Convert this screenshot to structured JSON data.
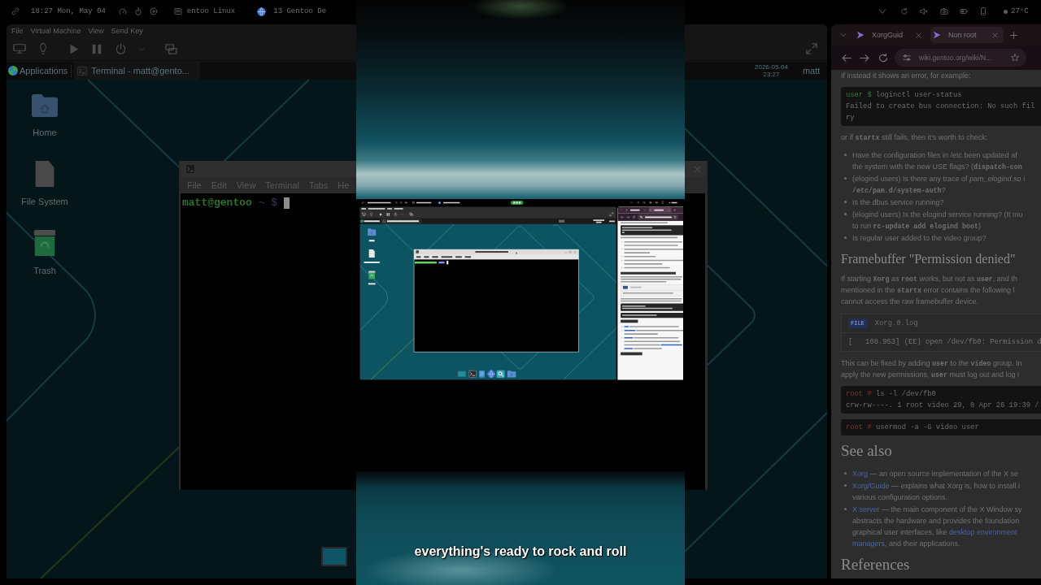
{
  "left_backdrop": {
    "top_bar": {
      "clock": "18:27 Mon, May 04",
      "window_title": "entoo Linux",
      "workspace": "13 Gentoo De"
    },
    "vm_menu": [
      "File",
      "Virtual Machine",
      "View",
      "Send Key"
    ],
    "guest_panel": {
      "menu": "Applications",
      "task": "Terminal - matt@gento..."
    },
    "desktop_icons": [
      {
        "label": "Home",
        "kind": "folder"
      },
      {
        "label": "File System",
        "kind": "drive"
      },
      {
        "label": "Trash",
        "kind": "trash"
      }
    ],
    "terminal": {
      "menu": [
        "File",
        "Edit",
        "View",
        "Terminal",
        "Tabs",
        "He"
      ],
      "user_host": "matt@gentoo",
      "prompt_tail": "~ $"
    }
  },
  "video": {
    "subtitle": "everything's ready to rock and roll"
  },
  "right_backdrop": {
    "top_bar": {
      "temperature": "27°C"
    },
    "guest_panel": {
      "date": "2026-05-04",
      "time": "23:27",
      "user": "matt"
    },
    "browser": {
      "tabs": [
        {
          "label": "XorgGuid",
          "selected": false
        },
        {
          "label": "Non root",
          "selected": true
        }
      ],
      "url": "wiki.gentoo.org/wiki/N...",
      "blocks": [
        {
          "kind": "paragraph",
          "lines": [
            "If instead it shows an error, for example:"
          ]
        },
        {
          "kind": "code",
          "lines": [
            {
              "kind": "user_prompt",
              "prompt": "user $",
              "text": "loginctl user-status"
            },
            {
              "kind": "output",
              "text": "Failed to create bus connection: No such fil"
            },
            {
              "kind": "output",
              "text": "ry"
            }
          ]
        },
        {
          "kind": "paragraph",
          "lines": [
            "or if **startx** still fails, then it's worth to check:"
          ]
        },
        {
          "kind": "bullets",
          "items": [
            [
              "Have the configuration files in /etc been updated af",
              "the system with the new USE flags? (**dispatch-con**"
            ],
            [
              "(elogind users) Is there any trace of *pam_elogind.so* i",
              "**/etc/pam.d/system-auth**?"
            ],
            [
              "Is the dbus service running?"
            ],
            [
              "(elogind users) Is the elogind service running? (It mu",
              "to run **rc-update add elogind boot**)"
            ],
            [
              "Is regular user added to the video group?"
            ]
          ]
        },
        {
          "kind": "heading",
          "text": "Framebuffer \"Permission denied\""
        },
        {
          "kind": "paragraph",
          "lines": [
            "If starting **Xorg** as **root** works, but not as **user**, and th",
            "mentioned in the **startx** error contains the following l",
            "cannot access the raw framebuffer device."
          ]
        },
        {
          "kind": "file",
          "badge": "FILE",
          "name": "Xorg.0.log",
          "lines": [
            "[   108.953] (EE) open /dev/fb0: Permission d"
          ]
        },
        {
          "kind": "paragraph",
          "lines": [
            "This can be fixed by adding **user** to the **video** group. In",
            "apply the new permissions, **user** must log out and log i"
          ]
        },
        {
          "kind": "code",
          "lines": [
            {
              "kind": "root_prompt",
              "prompt": "root #",
              "text": "ls -l /dev/fb0"
            },
            {
              "kind": "output",
              "text": "crw-rw----. 1 root video 29, 0 Apr 26 19:39 /"
            }
          ]
        },
        {
          "kind": "code",
          "lines": [
            {
              "kind": "root_prompt",
              "prompt": "root #",
              "text": "usermod -a -G video user"
            }
          ]
        },
        {
          "kind": "section_heading",
          "text": "See also"
        },
        {
          "kind": "link_bullets",
          "items": [
            [
              [
                {
                  "kind": "link",
                  "text": "Xorg"
                },
                {
                  "kind": "text",
                  "text": " — an open source implementation of the X se"
                }
              ]
            ],
            [
              [
                {
                  "kind": "link",
                  "text": "Xorg/Guide"
                },
                {
                  "kind": "text",
                  "text": " — explains what Xorg is, how to install i"
                }
              ],
              [
                {
                  "kind": "text",
                  "text": "various configuration options."
                }
              ]
            ],
            [
              [
                {
                  "kind": "link",
                  "text": "X server"
                },
                {
                  "kind": "text",
                  "text": " — the main component of the X Window sy"
                }
              ],
              [
                {
                  "kind": "text",
                  "text": "abstracts the hardware and provides the foundation"
                }
              ],
              [
                {
                  "kind": "text",
                  "text": "graphical user interfaces, like "
                },
                {
                  "kind": "link",
                  "text": "desktop environment"
                }
              ],
              [
                {
                  "kind": "link",
                  "text": "managers"
                },
                {
                  "kind": "text",
                  "text": ", and their applications."
                }
              ]
            ]
          ]
        },
        {
          "kind": "section_heading",
          "text": "References"
        }
      ]
    }
  }
}
